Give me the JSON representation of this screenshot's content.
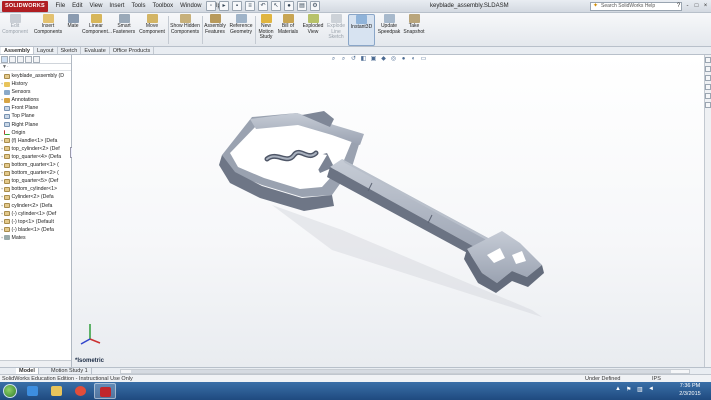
{
  "app": {
    "brand": "SOLIDWORKS",
    "document_title": "keyblade_assembly.SLDASM",
    "menus": [
      "File",
      "Edit",
      "View",
      "Insert",
      "Tools",
      "Toolbox",
      "Window",
      "Help"
    ],
    "search_placeholder": "Search SolidWorks Help",
    "window_controls": [
      "?",
      "-",
      "□",
      "×"
    ]
  },
  "command_manager": {
    "items": [
      {
        "label": "Edit Component",
        "icon": "edit-component-icon",
        "enabled": false
      },
      {
        "label": "Insert Components",
        "icon": "insert-components-icon",
        "enabled": true
      },
      {
        "label": "Mate",
        "icon": "mate-icon",
        "enabled": true
      },
      {
        "label": "Linear Component...",
        "icon": "linear-pattern-icon",
        "enabled": true
      },
      {
        "label": "Smart Fasteners",
        "icon": "smart-fasteners-icon",
        "enabled": true
      },
      {
        "label": "Move Component",
        "icon": "move-component-icon",
        "enabled": true
      },
      {
        "label": "Show Hidden Components",
        "icon": "show-hidden-icon",
        "enabled": true
      },
      {
        "label": "Assembly Features",
        "icon": "assembly-features-icon",
        "enabled": true
      },
      {
        "label": "Reference Geometry",
        "icon": "reference-geometry-icon",
        "enabled": true
      },
      {
        "label": "New Motion Study",
        "icon": "motion-study-icon",
        "enabled": true
      },
      {
        "label": "Bill of Materials",
        "icon": "bom-icon",
        "enabled": true
      },
      {
        "label": "Exploded View",
        "icon": "exploded-view-icon",
        "enabled": true
      },
      {
        "label": "Explode Line Sketch",
        "icon": "explode-line-icon",
        "enabled": false
      },
      {
        "label": "Instant3D",
        "icon": "instant3d-icon",
        "enabled": true,
        "active": true
      },
      {
        "label": "Update Speedpak",
        "icon": "speedpak-icon",
        "enabled": true
      },
      {
        "label": "Take Snapshot",
        "icon": "snapshot-icon",
        "enabled": true
      }
    ]
  },
  "tabs": [
    {
      "label": "Assembly",
      "active": true
    },
    {
      "label": "Layout",
      "active": false
    },
    {
      "label": "Sketch",
      "active": false
    },
    {
      "label": "Evaluate",
      "active": false
    },
    {
      "label": "Office Products",
      "active": false
    }
  ],
  "feature_tree": {
    "root": "keyblade_assembly (D",
    "items": [
      {
        "label": "History",
        "icon": "folder"
      },
      {
        "label": "Sensors",
        "icon": "sensor"
      },
      {
        "label": "Annotations",
        "icon": "annot"
      },
      {
        "label": "Front Plane",
        "icon": "plane"
      },
      {
        "label": "Top Plane",
        "icon": "plane"
      },
      {
        "label": "Right Plane",
        "icon": "plane"
      },
      {
        "label": "Origin",
        "icon": "origin"
      },
      {
        "label": "(f) Handle<1> (Defa",
        "icon": "part"
      },
      {
        "label": "top_cylinder<2> (Def",
        "icon": "part"
      },
      {
        "label": "top_quarter<4> (Defa",
        "icon": "part"
      },
      {
        "label": "bottom_quarter<1> (",
        "icon": "part"
      },
      {
        "label": "bottom_quarter<2> (",
        "icon": "part"
      },
      {
        "label": "top_quarter<5> (Def",
        "icon": "part"
      },
      {
        "label": "bottom_cylinder<1>",
        "icon": "part"
      },
      {
        "label": "Cylinder<2> (Defa",
        "icon": "part"
      },
      {
        "label": "cylinder<2> (Defa",
        "icon": "part"
      },
      {
        "label": "(-) cylinder<1> (Def",
        "icon": "part"
      },
      {
        "label": "(-) top<1> (Default",
        "icon": "part"
      },
      {
        "label": "(-) blade<1> (Defa",
        "icon": "part"
      },
      {
        "label": "Mates",
        "icon": "mates"
      }
    ]
  },
  "viewport": {
    "view_label": "*Isometric"
  },
  "bottom_tabs": [
    {
      "label": "Model",
      "active": true
    },
    {
      "label": "Motion Study 1",
      "active": false
    }
  ],
  "status": {
    "left": "SolidWorks Education Edition - Instructional Use Only",
    "state": "Under Defined",
    "units": "IPS"
  },
  "taskbar": {
    "time": "7:36 PM",
    "date": "2/3/2015"
  }
}
